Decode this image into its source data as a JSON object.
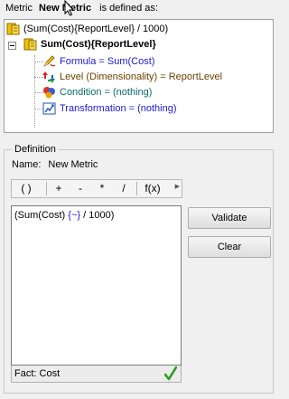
{
  "header": {
    "prefix": "Metric",
    "metric_name": "New Metric",
    "suffix": "is defined as:"
  },
  "tree": {
    "root": "(Sum(Cost){ReportLevel} / 1000)",
    "node": "Sum(Cost){ReportLevel}",
    "children": {
      "formula": "Formula = Sum(Cost)",
      "level": "Level (Dimensionality) = ReportLevel",
      "condition": "Condition = (nothing)",
      "transformation": "Transformation = (nothing)"
    }
  },
  "definition": {
    "legend": "Definition",
    "name_label": "Name:",
    "name_value": "New Metric",
    "operators": [
      "( )",
      "+",
      "-",
      "*",
      "/",
      "f(x)"
    ],
    "formula_prefix": "(Sum(Cost) ",
    "formula_tilde": "{~}",
    "formula_suffix": " / 1000)",
    "status": "Fact: Cost",
    "validate_label": "Validate",
    "clear_label": "Clear"
  },
  "colors": {
    "formula": "#1a1ad0",
    "level": "#6b3f00",
    "condition": "#0a6b6b",
    "transformation": "#1a1ad0",
    "check": "#2e9e1e"
  }
}
